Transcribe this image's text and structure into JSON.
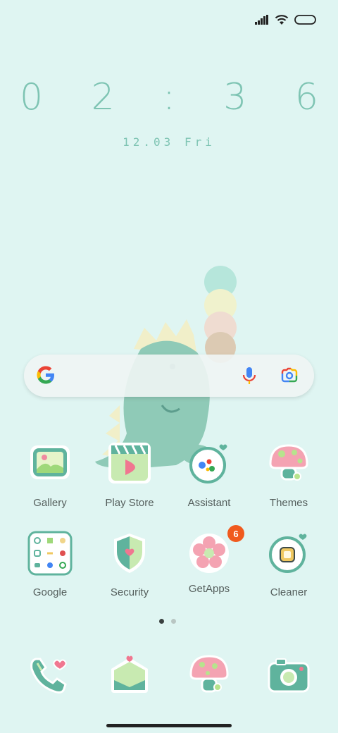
{
  "clock": {
    "time": "0 2 : 3 6",
    "date": "12.03 Fri"
  },
  "status_bar": {
    "icons": [
      "signal-icon",
      "wifi-icon",
      "battery-icon"
    ]
  },
  "search": {
    "icons": [
      "google-logo-icon",
      "mic-icon",
      "lens-camera-icon"
    ]
  },
  "apps": [
    {
      "label": "Gallery",
      "icon": "gallery-icon"
    },
    {
      "label": "Play Store",
      "icon": "play-store-icon"
    },
    {
      "label": "Assistant",
      "icon": "assistant-icon"
    },
    {
      "label": "Themes",
      "icon": "mushroom-icon"
    },
    {
      "label": "Google",
      "icon": "google-folder-icon"
    },
    {
      "label": "Security",
      "icon": "shield-icon"
    },
    {
      "label": "GetApps",
      "icon": "flower-icon",
      "badge": "6"
    },
    {
      "label": "Cleaner",
      "icon": "cleaner-icon"
    }
  ],
  "page_indicator": {
    "pages": 2,
    "current": 1
  },
  "dock": [
    {
      "icon": "phone-icon"
    },
    {
      "icon": "messages-envelope-icon"
    },
    {
      "icon": "mushroom-browser-icon"
    },
    {
      "icon": "camera-icon"
    }
  ],
  "colors": {
    "background": "#dff5f2",
    "accent": "#7ec4b3",
    "badge": "#f05a1e"
  }
}
